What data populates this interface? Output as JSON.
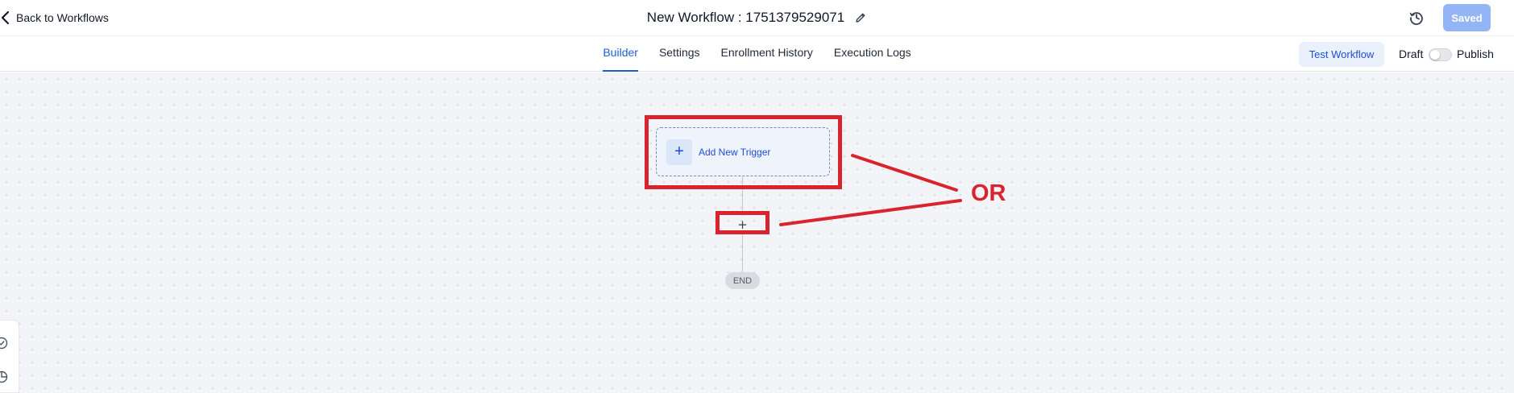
{
  "header": {
    "back_label": "Back to Workflows",
    "title": "New Workflow : 1751379529071",
    "saved_label": "Saved",
    "saved_color": "#93b4f5"
  },
  "tabs": [
    {
      "label": "Builder",
      "active": true
    },
    {
      "label": "Settings",
      "active": false
    },
    {
      "label": "Enrollment History",
      "active": false
    },
    {
      "label": "Execution Logs",
      "active": false
    }
  ],
  "actions": {
    "test_label": "Test Workflow",
    "draft_label": "Draft",
    "publish_label": "Publish",
    "publish_toggle_on": false
  },
  "canvas": {
    "trigger_label": "Add New Trigger",
    "add_step_symbol": "+",
    "end_label": "END"
  },
  "annotation": {
    "label": "OR",
    "color": "#d9232e"
  },
  "icons": {
    "back": "chevron-left-icon",
    "edit": "pencil-icon",
    "history": "history-icon",
    "trigger": "plus-icon",
    "side_tools": [
      "check-circle-icon",
      "pie-chart-icon"
    ]
  },
  "colors": {
    "accent": "#1d5fd1",
    "canvas_bg": "#f3f4f7",
    "trigger_border": "#6b8fc5"
  }
}
